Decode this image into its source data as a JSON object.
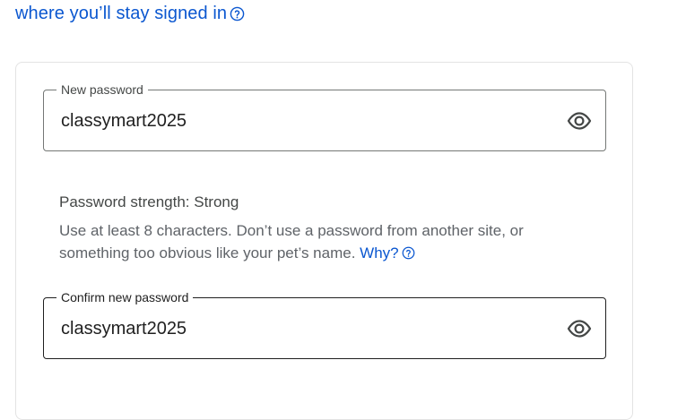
{
  "top_link": {
    "text": "where you’ll stay signed in"
  },
  "new_password": {
    "label": "New password",
    "value": "classymart2025"
  },
  "strength": {
    "text": "Password strength: Strong"
  },
  "hint": {
    "text": "Use at least 8 characters. Don’t use a password from another site, or something too obvious like your pet’s name.",
    "why_label": "Why?"
  },
  "confirm_password": {
    "label": "Confirm new password",
    "value": "classymart2025"
  },
  "colors": {
    "link": "#0b57d0",
    "text": "#1f1f1f",
    "secondary": "#444746",
    "hint": "#5f6368",
    "border": "#747775"
  }
}
